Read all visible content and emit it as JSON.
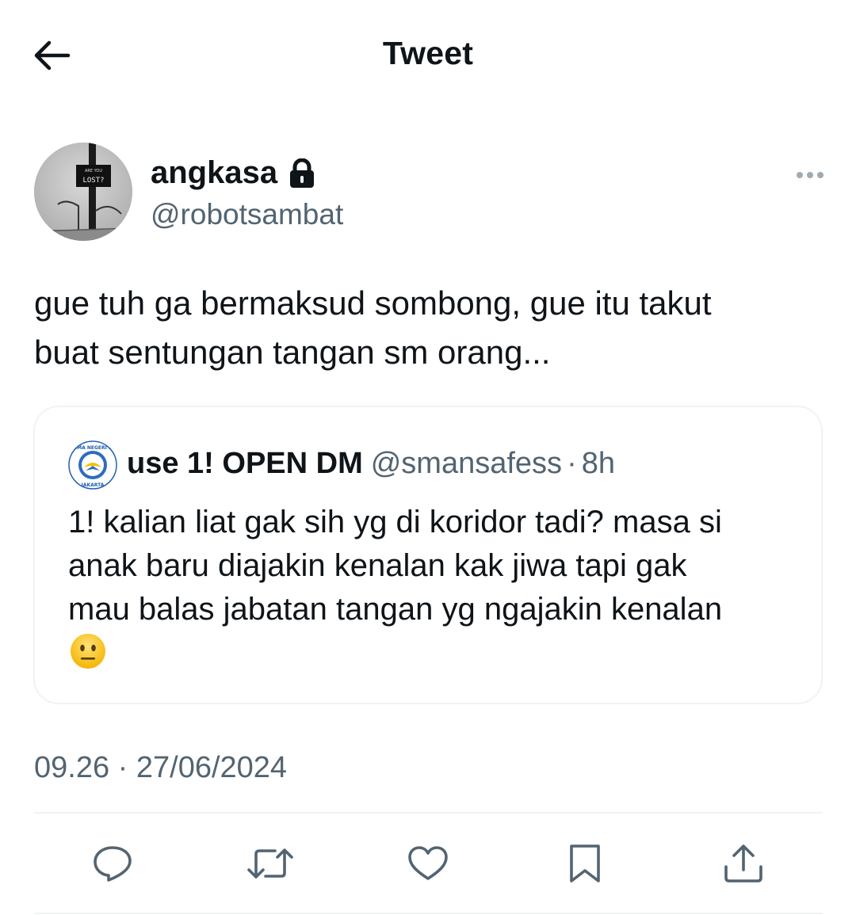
{
  "header": {
    "title": "Tweet",
    "back_icon": "arrow-left-icon"
  },
  "author": {
    "display_name": "angkasa",
    "handle": "@robotsambat",
    "protected": true,
    "avatar_sign_text_1": "ARE YOU",
    "avatar_sign_text_2": "LOST?"
  },
  "tweet": {
    "text_lines": [
      "gue tuh ga bermaksud sombong, gue itu takut",
      "buat sentungan tangan sm orang..."
    ],
    "timestamp": "09.26 · 27/06/2024"
  },
  "quote": {
    "name": "use 1! OPEN DM",
    "handle": "@smansafess",
    "separator": "·",
    "time": "8h",
    "avatar_logo_top": "SMA NEGERI 1",
    "avatar_logo_bottom": "JAKARTA",
    "text_lines": [
      "1! kalian liat gak sih yg di koridor tadi? masa si",
      "anak baru diajakin kenalan kak jiwa tapi gak",
      "mau balas jabatan tangan yg ngajakin kenalan"
    ],
    "emoji": "neutral-face-emoji"
  },
  "actions": [
    "reply-icon",
    "retweet-icon",
    "like-icon",
    "bookmark-icon",
    "share-icon"
  ],
  "colors": {
    "text_primary": "#0f1419",
    "text_secondary": "#536471",
    "border": "#eff3f4"
  }
}
